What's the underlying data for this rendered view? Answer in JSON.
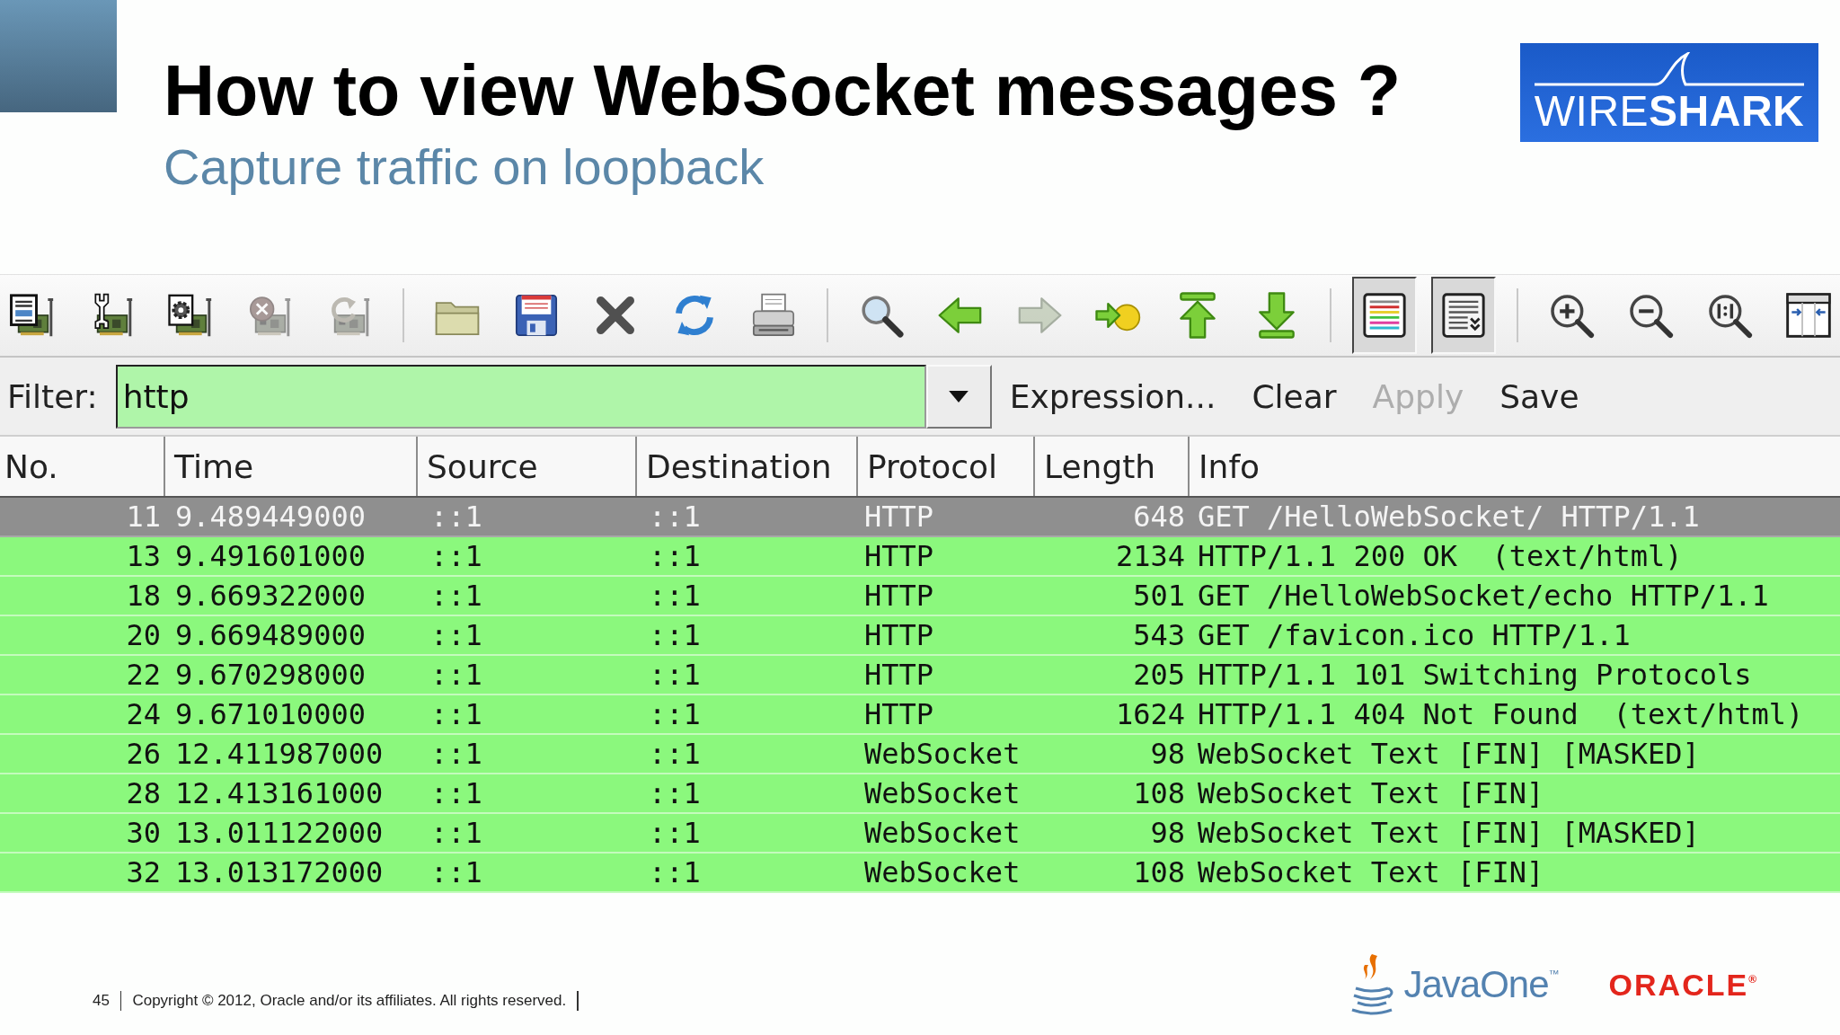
{
  "slide": {
    "title": "How to view WebSocket messages ?",
    "subtitle": "Capture traffic on loopback",
    "logo": "WIRE**SHARK**"
  },
  "toolbar": {
    "groups": [
      {
        "buttons": [
          {
            "pressed": false,
            "disabled": false
          },
          {
            "pressed": false,
            "disabled": false
          },
          {
            "pressed": false,
            "disabled": false
          },
          {
            "pressed": false,
            "disabled": true
          },
          {
            "pressed": false,
            "disabled": true
          }
        ]
      },
      {
        "buttons": [
          {
            "pressed": false,
            "disabled": false
          },
          {
            "pressed": false,
            "disabled": false
          },
          {
            "pressed": false,
            "disabled": false
          },
          {
            "pressed": false,
            "disabled": false
          },
          {
            "pressed": false,
            "disabled": false
          }
        ]
      },
      {
        "buttons": [
          {
            "pressed": false,
            "disabled": false
          },
          {
            "pressed": false,
            "disabled": false
          },
          {
            "pressed": false,
            "disabled": true
          },
          {
            "pressed": false,
            "disabled": false
          },
          {
            "pressed": false,
            "disabled": false
          },
          {
            "pressed": false,
            "disabled": false
          }
        ]
      },
      {
        "buttons": [
          {
            "pressed": true,
            "disabled": false
          },
          {
            "pressed": true,
            "disabled": false
          }
        ]
      },
      {
        "buttons": [
          {
            "pressed": false,
            "disabled": false
          },
          {
            "pressed": false,
            "disabled": false
          },
          {
            "pressed": false,
            "disabled": false
          },
          {
            "pressed": false,
            "disabled": false
          }
        ]
      }
    ]
  },
  "filter": {
    "label": "Filter:",
    "value": "http",
    "valid": true,
    "buttons": [
      {
        "label": "Expression...",
        "disabled": false
      },
      {
        "label": "Clear",
        "disabled": false
      },
      {
        "label": "Apply",
        "disabled": true
      },
      {
        "label": "Save",
        "disabled": false
      }
    ]
  },
  "packet_list": {
    "columns": [
      "No.",
      "Time",
      "Source",
      "Destination",
      "Protocol",
      "Length",
      "Info"
    ],
    "rows": [
      {
        "selected": true,
        "cells": [
          "11",
          "9.489449000",
          "::1",
          "::1",
          "HTTP",
          "648",
          "GET /HelloWebSocket/ HTTP/1.1"
        ]
      },
      {
        "selected": false,
        "cells": [
          "13",
          "9.491601000",
          "::1",
          "::1",
          "HTTP",
          "2134",
          "HTTP/1.1 200 OK  (text/html)"
        ]
      },
      {
        "selected": false,
        "cells": [
          "18",
          "9.669322000",
          "::1",
          "::1",
          "HTTP",
          "501",
          "GET /HelloWebSocket/echo HTTP/1.1"
        ]
      },
      {
        "selected": false,
        "cells": [
          "20",
          "9.669489000",
          "::1",
          "::1",
          "HTTP",
          "543",
          "GET /favicon.ico HTTP/1.1"
        ]
      },
      {
        "selected": false,
        "cells": [
          "22",
          "9.670298000",
          "::1",
          "::1",
          "HTTP",
          "205",
          "HTTP/1.1 101 Switching Protocols"
        ]
      },
      {
        "selected": false,
        "cells": [
          "24",
          "9.671010000",
          "::1",
          "::1",
          "HTTP",
          "1624",
          "HTTP/1.1 404 Not Found  (text/html)"
        ]
      },
      {
        "selected": false,
        "cells": [
          "26",
          "12.411987000",
          "::1",
          "::1",
          "WebSocket",
          "98",
          "WebSocket Text [FIN] [MASKED]"
        ]
      },
      {
        "selected": false,
        "cells": [
          "28",
          "12.413161000",
          "::1",
          "::1",
          "WebSocket",
          "108",
          "WebSocket Text [FIN]"
        ]
      },
      {
        "selected": false,
        "cells": [
          "30",
          "13.011122000",
          "::1",
          "::1",
          "WebSocket",
          "98",
          "WebSocket Text [FIN] [MASKED]"
        ]
      },
      {
        "selected": false,
        "cells": [
          "32",
          "13.013172000",
          "::1",
          "::1",
          "WebSocket",
          "108",
          "WebSocket Text [FIN]"
        ]
      }
    ]
  },
  "footer": {
    "page_number": "45",
    "copyright": "Copyright © 2012, Oracle and/or its affiliates. All rights reserved.",
    "event_logo": "JavaOne$^{™}$",
    "company_logo": "ORACLE$^{®}$"
  }
}
